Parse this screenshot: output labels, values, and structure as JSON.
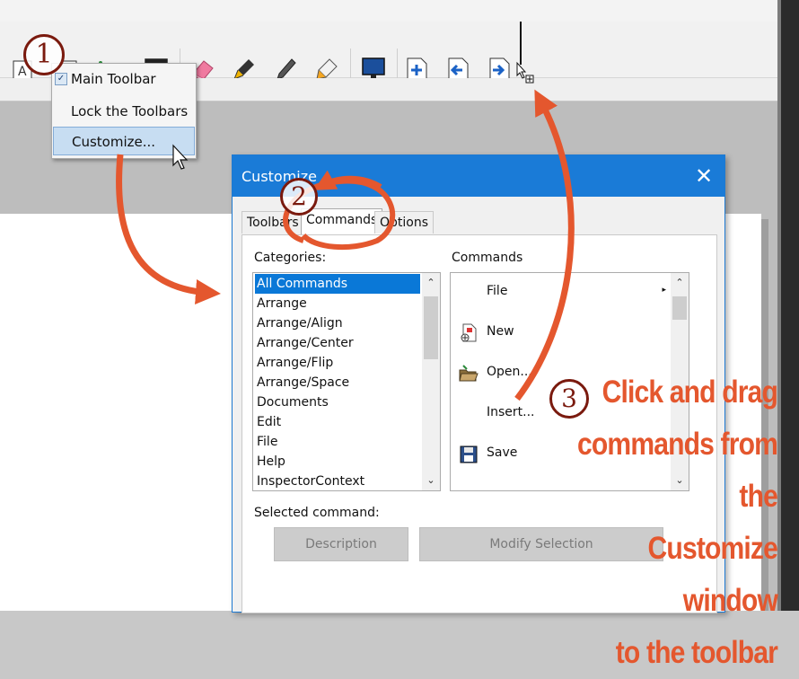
{
  "context_menu": {
    "items": [
      {
        "label": "Main Toolbar",
        "checked": true
      },
      {
        "label": "Lock the Toolbars"
      },
      {
        "label": "Customize..."
      }
    ]
  },
  "toolbar": {
    "icons": [
      "text-frame-icon",
      "linked-frame-icon",
      "node-edit-icon",
      "table-icon",
      "eraser-icon",
      "eyedropper-icon",
      "pen-icon",
      "glue-icon",
      "monitor-icon",
      "insert-page-icon",
      "previous-page-icon",
      "next-page-icon"
    ]
  },
  "dialog": {
    "title": "Customize",
    "close_glyph": "✕",
    "tabs": [
      "Toolbars",
      "Commands",
      "Options"
    ],
    "active_tab": "Commands",
    "categories_label": "Categories:",
    "categories": [
      "All Commands",
      "Arrange",
      "Arrange/Align",
      "Arrange/Center",
      "Arrange/Flip",
      "Arrange/Space",
      "Documents",
      "Edit",
      "File",
      "Help",
      "InspectorContext"
    ],
    "selected_category": "All Commands",
    "commands_label": "Commands",
    "commands": [
      {
        "label": "File",
        "icon": "none",
        "has_submenu": true
      },
      {
        "label": "New",
        "icon": "new-document-icon"
      },
      {
        "label": "Open...",
        "icon": "open-folder-icon"
      },
      {
        "label": "Insert...",
        "icon": "none"
      },
      {
        "label": "Save",
        "icon": "save-disk-icon"
      }
    ],
    "selected_command_label": "Selected command:",
    "description_button": "Description",
    "modify_selection_button": "Modify Selection"
  },
  "annotations": {
    "step1": "1",
    "step2": "2",
    "step3": "3",
    "instruction_lines": [
      "Click and drag",
      "commands from the",
      "Customize window",
      "to the toolbar"
    ],
    "accent_color": "#e4572e",
    "circle_color": "#7a1a0e"
  },
  "colors": {
    "titlebar": "#1a7bd7",
    "selection": "#0a78d7",
    "menu_highlight": "#c7ddf2"
  }
}
